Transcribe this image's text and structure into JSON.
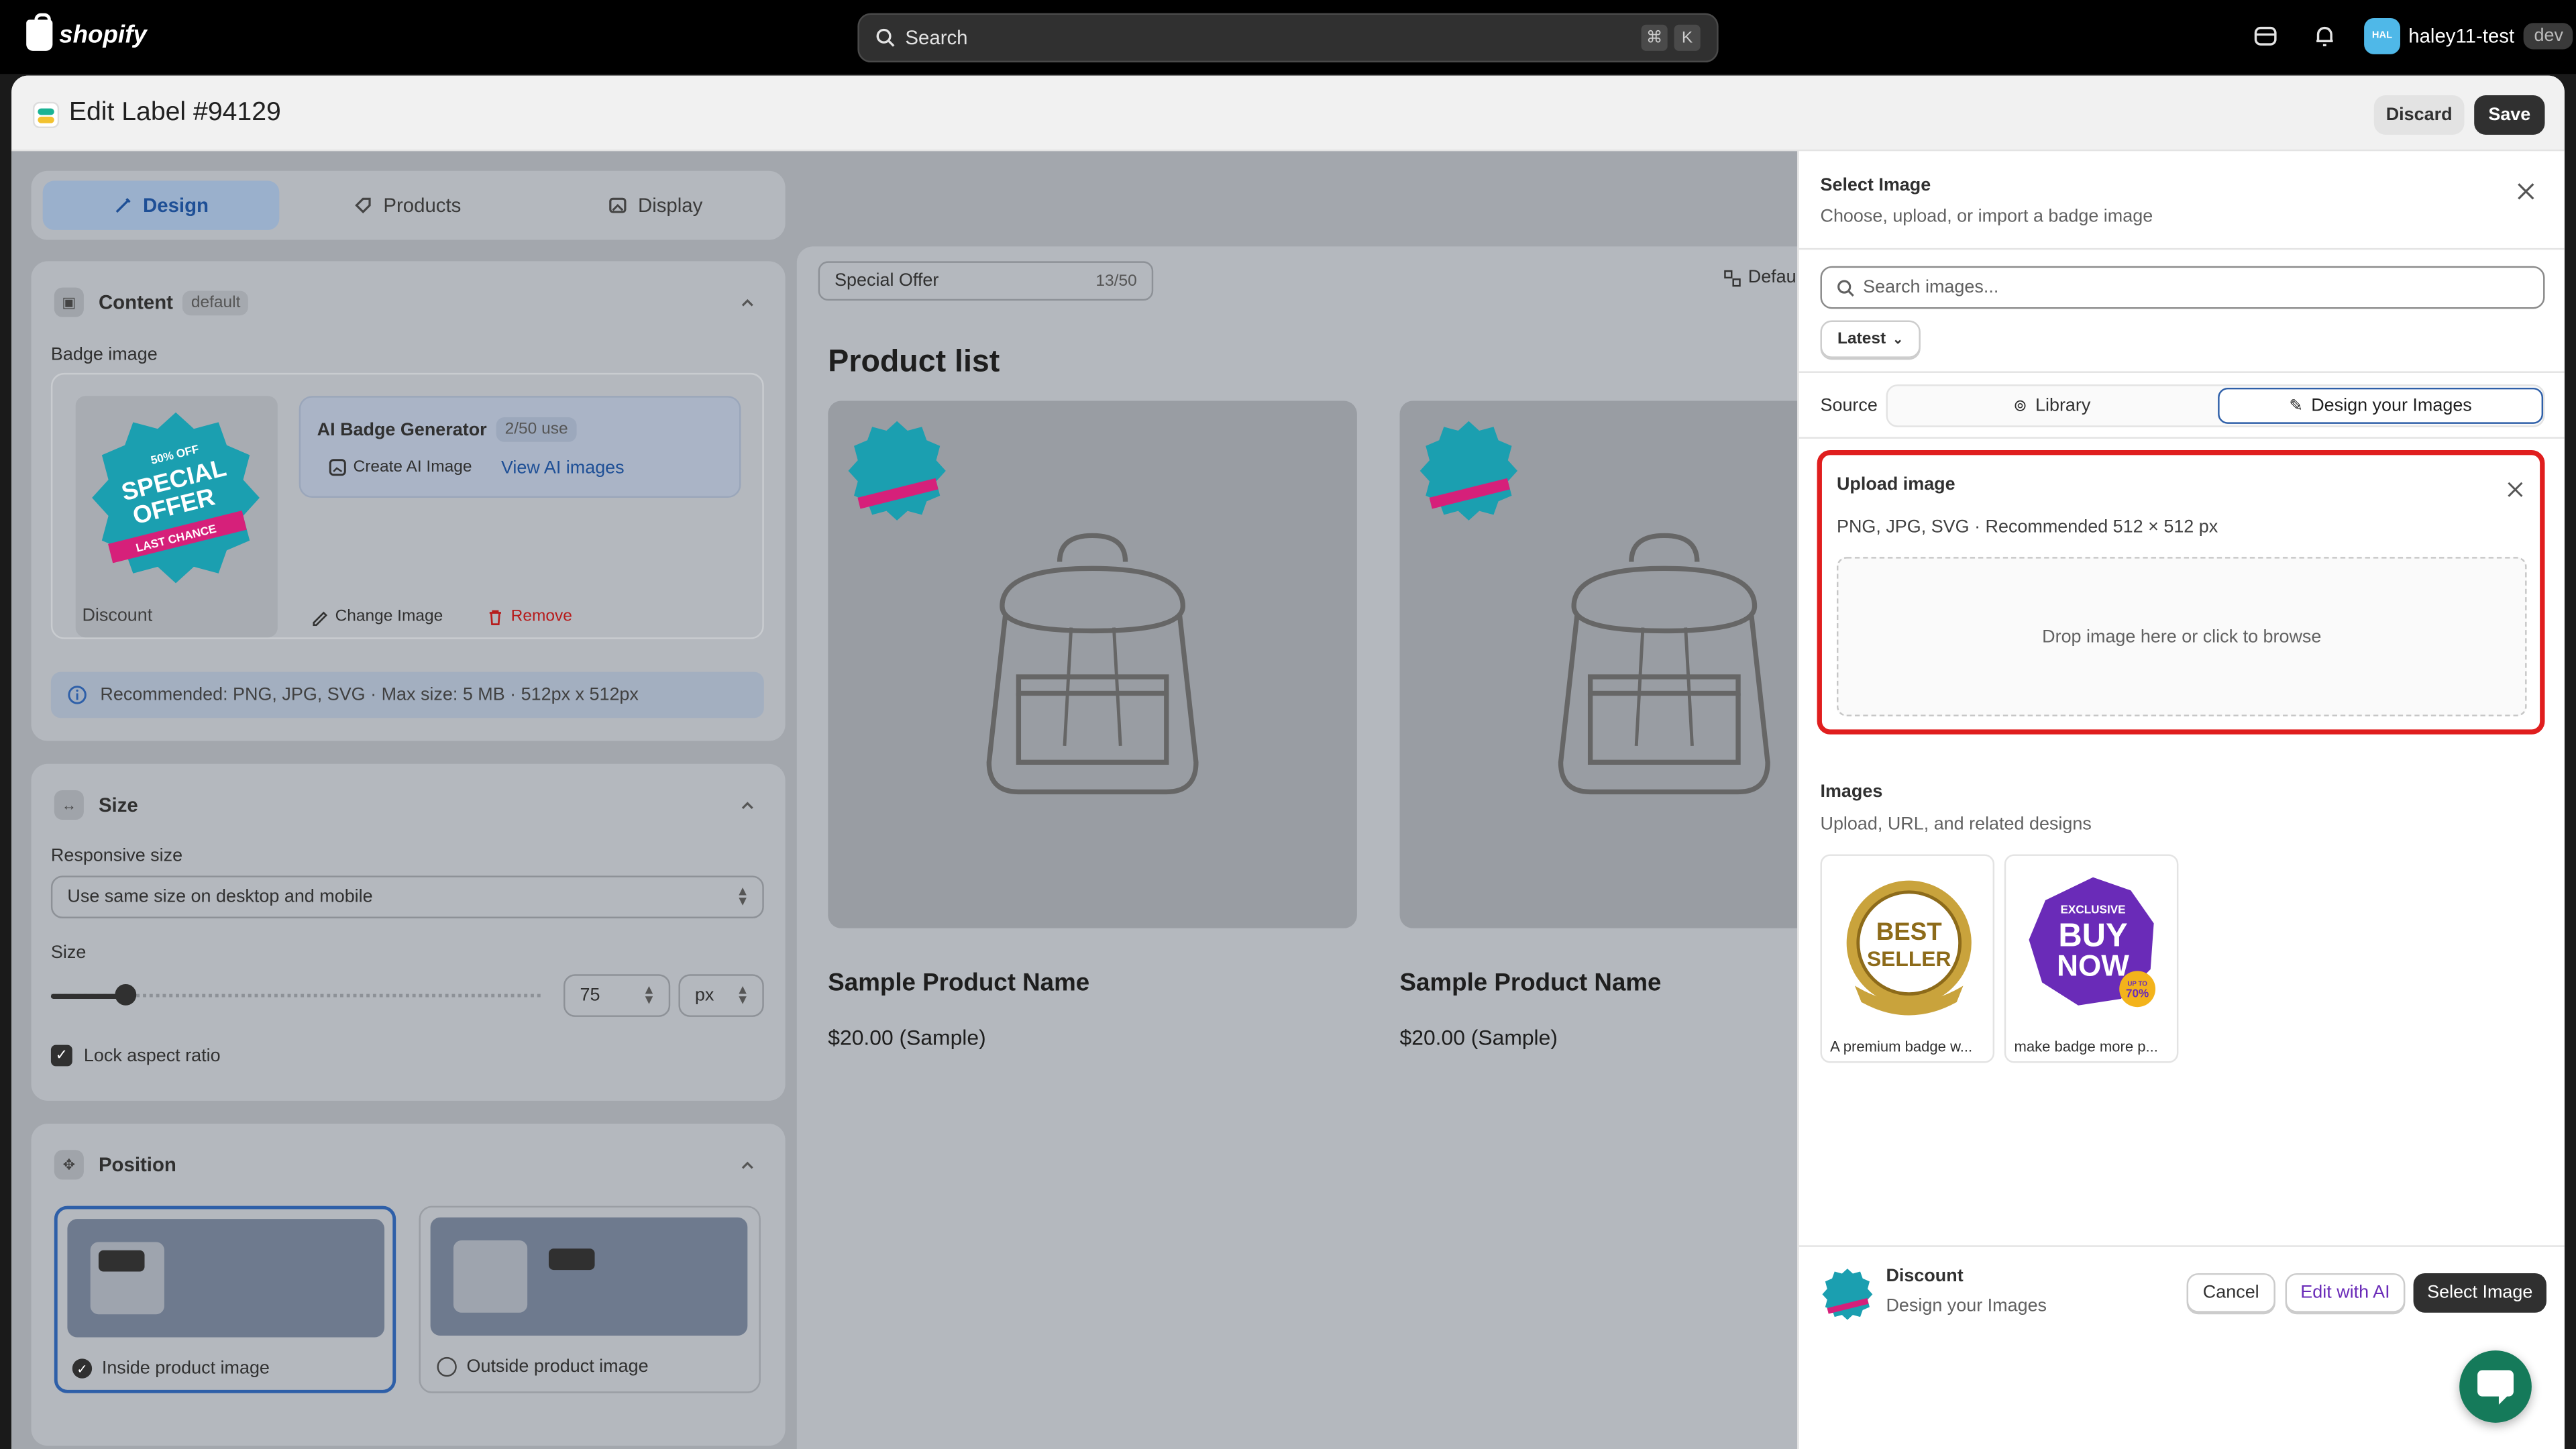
{
  "topbar": {
    "brand": "shopify",
    "search_placeholder": "Search",
    "kbd_cmd": "⌘",
    "kbd_k": "K",
    "user_initials": "HAL",
    "user_name": "haley11-test",
    "user_env": "dev"
  },
  "header": {
    "title": "Edit Label #94129",
    "discard_label": "Discard",
    "save_label": "Save"
  },
  "tabs": [
    {
      "label": "Design",
      "icon": "brush-icon",
      "active": true
    },
    {
      "label": "Products",
      "icon": "tag-icon"
    },
    {
      "label": "Display",
      "icon": "image-icon"
    }
  ],
  "content": {
    "title": "Content",
    "tag": "default",
    "badge_label": "Badge image",
    "badge_caption": "Discount",
    "badge_art": {
      "top": "50% OFF",
      "main1": "SPECIAL",
      "main2": "OFFER",
      "ribbon": "LAST CHANCE"
    },
    "ai_title": "AI Badge Generator",
    "ai_usage": "2/50 use",
    "ai_create": "Create AI Image",
    "ai_view": "View AI images",
    "change_image": "Change Image",
    "remove": "Remove",
    "info": "Recommended: PNG, JPG, SVG · Max size: 5 MB · 512px x 512px"
  },
  "size": {
    "title": "Size",
    "responsive_label": "Responsive size",
    "responsive_value": "Use same size on desktop and mobile",
    "size_label": "Size",
    "slider_percent": 15,
    "value": "75",
    "unit": "px",
    "lock_label": "Lock aspect ratio"
  },
  "position": {
    "title": "Position",
    "inside": "Inside product image",
    "outside": "Outside product image"
  },
  "preview": {
    "label_text": "Special Offer",
    "counter": "13/50",
    "default_btn": "Defau",
    "heading": "Product list",
    "products": [
      {
        "name": "Sample Product Name",
        "price": "$20.00 (Sample)"
      },
      {
        "name": "Sample Product Name",
        "price": "$20.00 (Sample)"
      }
    ]
  },
  "panel": {
    "title": "Select Image",
    "subtitle": "Choose, upload, or import a badge image",
    "search_placeholder": "Search images...",
    "sort": "Latest",
    "source_label": "Source",
    "source_library": "Library",
    "source_design": "Design your Images",
    "upload_title": "Upload image",
    "upload_hint": "PNG, JPG, SVG · Recommended 512 × 512 px",
    "drop_text": "Drop image here or click to browse",
    "images_title": "Images",
    "images_sub": "Upload, URL, and related designs",
    "thumbs": [
      {
        "caption": "A premium badge w...",
        "art1": "BEST",
        "art2": "SELLER"
      },
      {
        "caption": "make badge more p...",
        "art0": "EXCLUSIVE",
        "art1": "BUY",
        "art2": "NOW",
        "art3": "UP TO",
        "art4": "70%"
      }
    ],
    "footer_title": "Discount",
    "footer_sub": "Design your Images",
    "cancel": "Cancel",
    "edit_ai": "Edit with AI",
    "select": "Select Image"
  },
  "colors": {
    "accent": "#2e5fa8",
    "highlight": "#e01e1e",
    "primary_dark": "#303030"
  }
}
